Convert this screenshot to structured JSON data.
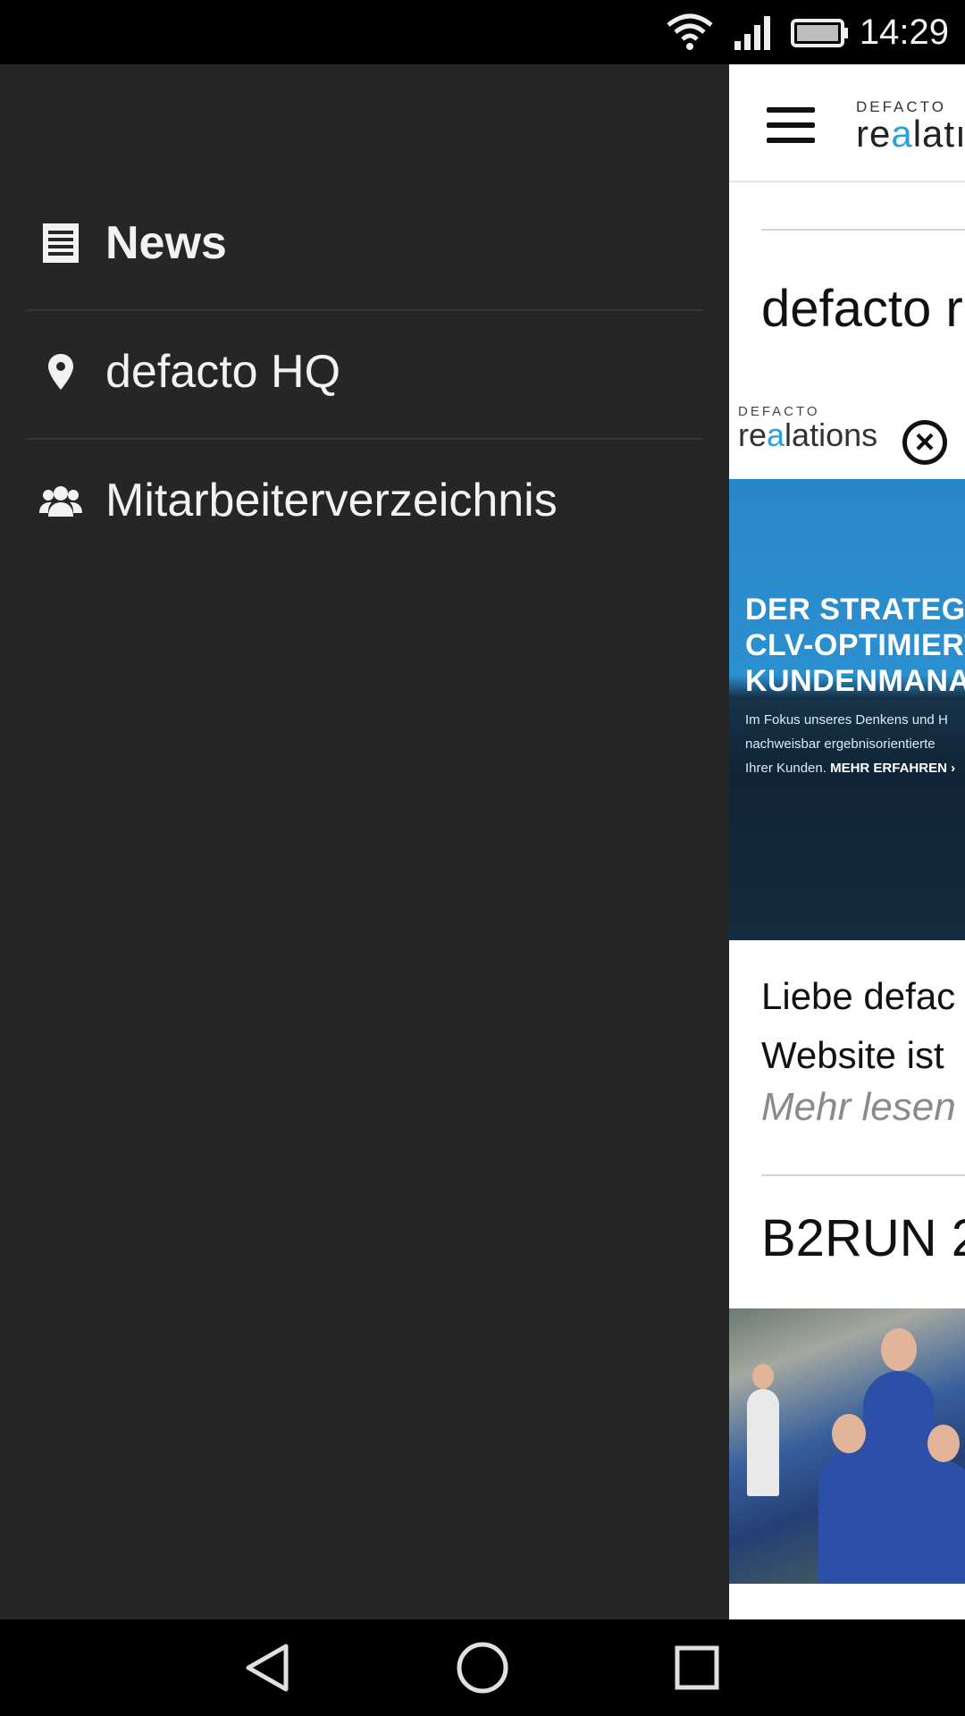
{
  "status_bar": {
    "time": "14:29",
    "icons": [
      "wifi-icon",
      "cell-signal-icon",
      "battery-icon"
    ]
  },
  "drawer": {
    "items": [
      {
        "label": "News",
        "icon": "news-list-icon",
        "active": true
      },
      {
        "label": "defacto HQ",
        "icon": "location-pin-icon",
        "active": false
      },
      {
        "label": "Mitarbeiterverzeichnis",
        "icon": "people-group-icon",
        "active": false
      }
    ]
  },
  "app": {
    "logo_top": "DEFACTO",
    "logo_word_prefix": "re",
    "logo_word_accent": "a",
    "logo_word_rest": "latı",
    "post1": {
      "title": "defacto r",
      "banner": {
        "brand_top": "DEFACTO",
        "brand_prefix": "re",
        "brand_accent": "a",
        "brand_rest": "lations",
        "headline": "DER STRATEGIS\nCLV-OPTIMIERT\nKUNDENMANA",
        "sub": "Im Fokus unseres Denkens und H\nnachweisbar ergebnisorientierte\nIhrer Kunden.",
        "more": "MEHR ERFAHREN ›"
      },
      "excerpt": "Liebe defac\nWebsite ist",
      "read_more": "Mehr lesen"
    },
    "post2": {
      "title": "B2RUN 2"
    }
  },
  "colors": {
    "drawer_bg": "#262626",
    "accent_blue": "#2a9fd8",
    "status_bar_bg": "#000000"
  }
}
